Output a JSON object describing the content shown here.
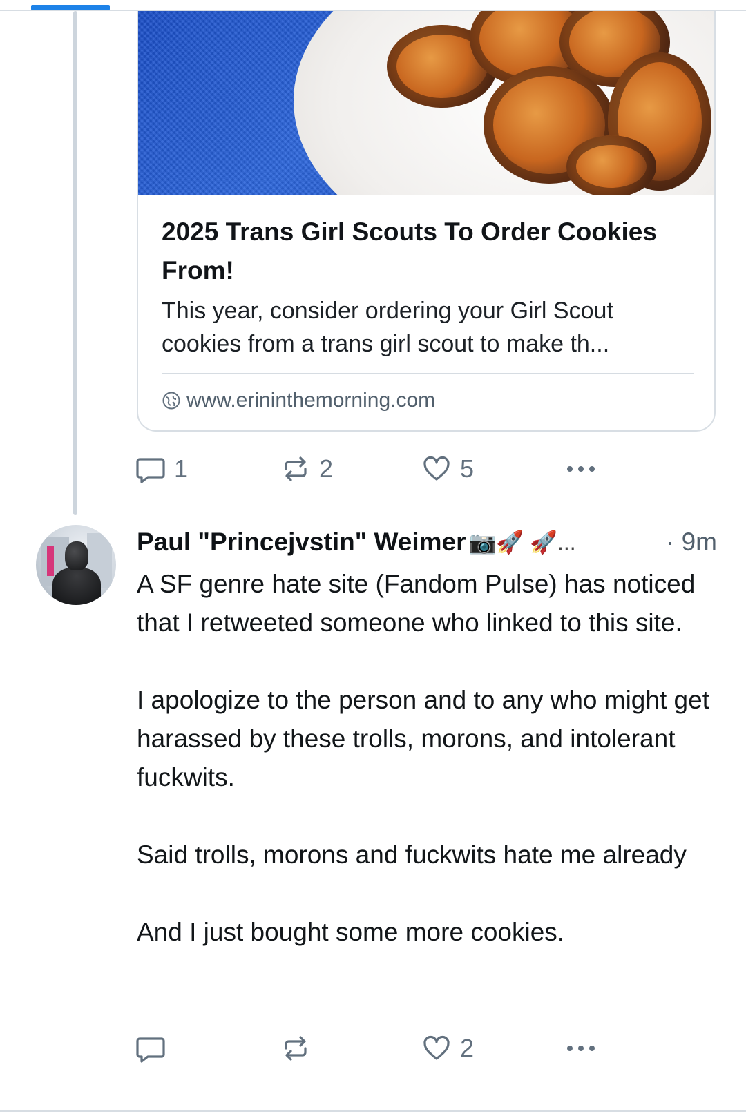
{
  "first_post": {
    "link_card": {
      "title": "2025 Trans Girl Scouts To Order Cookies From!",
      "description": "This year, consider ordering your Girl Scout cookies from a trans girl scout to make th...",
      "domain": "www.erininthemorning.com"
    },
    "actions": {
      "reply_count": "1",
      "repost_count": "2",
      "like_count": "5"
    }
  },
  "second_post": {
    "author": {
      "display_name": "Paul \"Princejvstin\" Weimer",
      "emoji_suffix": "📷🚀 🚀...",
      "time_prefix": "·",
      "time": "9m"
    },
    "body": [
      "A SF genre hate site (Fandom Pulse) has noticed that I retweeted someone who linked to this site.",
      "I apologize to the person and to any who might get harassed by these trolls, morons, and intolerant fuckwits.",
      "Said trolls, morons and fuckwits hate me already",
      "And I just bought some more cookies."
    ],
    "actions": {
      "reply_count": "",
      "repost_count": "",
      "like_count": "2"
    }
  },
  "colors": {
    "accent": "#1d82e8",
    "muted_text": "#62707e",
    "border": "#d8dee4"
  },
  "icons": [
    "reply-icon",
    "repost-icon",
    "like-icon",
    "more-icon",
    "globe-icon"
  ]
}
